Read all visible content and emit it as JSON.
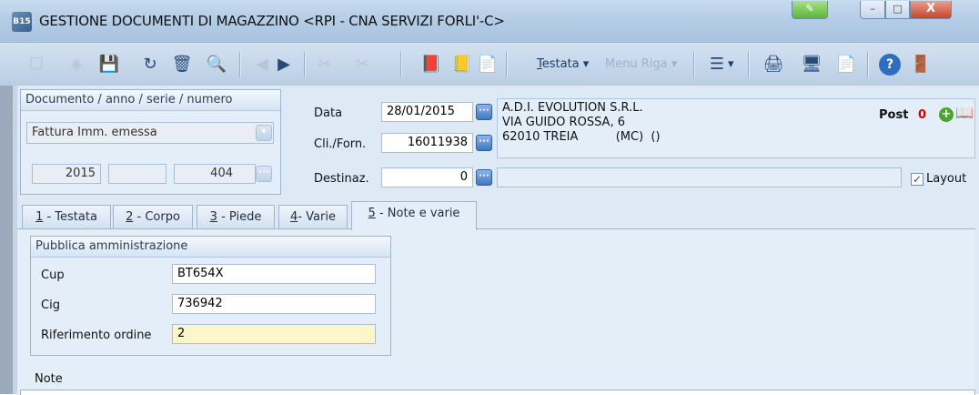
{
  "window": {
    "app_icon_text": "B15",
    "title": "GESTIONE DOCUMENTI DI MAGAZZINO <RPI - CNA SERVIZI FORLI'-C>",
    "help_btn": "✎",
    "min_btn": "–",
    "max_btn": "□",
    "close_btn": "X"
  },
  "toolbar": {
    "new_icon": "☐",
    "dup_icon": "◈",
    "save_icon": "💾",
    "undo_icon": "↻",
    "delete_icon": "🗑",
    "find_icon": "🔍",
    "prev_icon": "◀",
    "next_icon": "▶",
    "cut_icon": "✂",
    "copy2_icon": "✂",
    "doc1_icon": "📕",
    "doc2_icon": "📒",
    "doc3_icon": "📄",
    "testata_menu": "Testata",
    "testata_ul": "T",
    "testata_rest": "estata",
    "menu_riga": "Menu Riga",
    "list_icon": "☰",
    "print_icon": "🖨",
    "screen_icon": "🖥",
    "pdf_icon": "📄",
    "help_icon": "?",
    "exit_icon": "🚪",
    "dropdown_arrow": "▾"
  },
  "document": {
    "group_title": "Documento / anno / serie / numero",
    "type": "Fattura Imm. emessa",
    "year": "2015",
    "series": "",
    "number": "404"
  },
  "header": {
    "data_label": "Data",
    "data_value": "28/01/2015",
    "cli_label": "Cli./Forn.",
    "cli_value": "16011938",
    "dest_label": "Destinaz.",
    "dest_value": "0",
    "address_line1": "A.D.I. EVOLUTION S.R.L.",
    "address_line2": "VIA GUIDO ROSSA, 6",
    "address_line3": "62010 TREIA          (MC)  ()",
    "post_label": "Post",
    "post_value": "0",
    "add_icon": "+",
    "book_icon": "📖",
    "layout_label": "Layout",
    "layout_checked": "✓"
  },
  "tabs": [
    {
      "ul": "1",
      "rest": " - Testata"
    },
    {
      "ul": "2",
      "rest": " - Corpo"
    },
    {
      "ul": "3",
      "rest": " - Piede"
    },
    {
      "ul": "4",
      "rest": "- Varie"
    },
    {
      "ul": "5",
      "rest": " - Note e varie"
    }
  ],
  "pa": {
    "title": "Pubblica amministrazione",
    "cup_label": "Cup",
    "cup_value": "BT654X",
    "cig_label": "Cig",
    "cig_value": "736942",
    "rif_label": "Riferimento ordine",
    "rif_value": "2"
  },
  "note_label": "Note",
  "colors": {
    "accent": "#3f78c4",
    "post_value": "#d40000",
    "field_highlight": "#fdf6c9"
  }
}
